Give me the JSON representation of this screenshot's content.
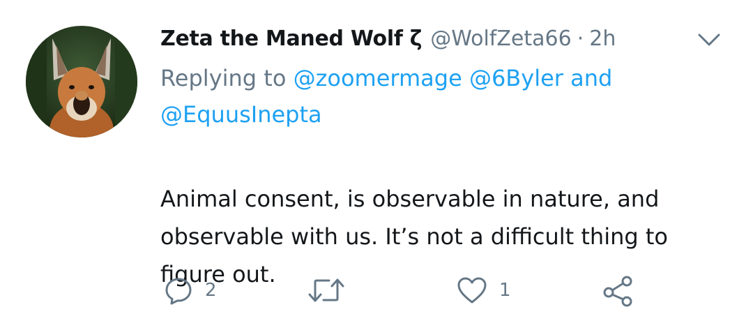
{
  "tweet": {
    "display_name": "Zeta the Maned Wolf ζ",
    "handle": "@WolfZeta66",
    "separator": "·",
    "time": "2h",
    "replying_prefix": "Replying to",
    "mentions": [
      "@zoomermage",
      "@6Byler"
    ],
    "mention_joiner": "and",
    "mention_last": "@EquusInepta",
    "text": "Animal consent, is observable in nature, and observable with us. It’s not a difficult thing to figure out.",
    "reply_count": "2",
    "like_count": "1"
  },
  "icons": {
    "menu": "chevron-down-icon",
    "reply": "reply-icon",
    "retweet": "retweet-icon",
    "like": "heart-icon",
    "share": "share-icon"
  },
  "colors": {
    "text": "#14171a",
    "secondary": "#657786",
    "link": "#1da1f2",
    "icon": "#657786"
  }
}
